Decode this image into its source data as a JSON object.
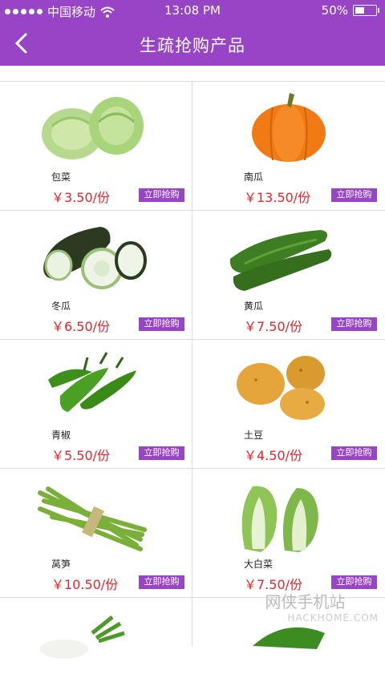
{
  "status": {
    "carrier": "中国移动",
    "time": "13:08 PM",
    "battery": "50%",
    "battery_level": 0.5
  },
  "header": {
    "title": "生疏抢购产品"
  },
  "products": [
    {
      "name": "包菜",
      "price": "￥3.50/份",
      "buy": "立即抢购",
      "icon": "cabbage-image"
    },
    {
      "name": "南瓜",
      "price": "￥13.50/份",
      "buy": "立即抢购",
      "icon": "pumpkin-image"
    },
    {
      "name": "冬瓜",
      "price": "￥6.50/份",
      "buy": "立即抢购",
      "icon": "winter-melon-image"
    },
    {
      "name": "黄瓜",
      "price": "￥7.50/份",
      "buy": "立即抢购",
      "icon": "cucumber-image"
    },
    {
      "name": "青椒",
      "price": "￥5.50/份",
      "buy": "立即抢购",
      "icon": "green-pepper-image"
    },
    {
      "name": "土豆",
      "price": "￥4.50/份",
      "buy": "立即抢购",
      "icon": "potato-image"
    },
    {
      "name": "莴笋",
      "price": "￥10.50/份",
      "buy": "立即抢购",
      "icon": "asparagus-image"
    },
    {
      "name": "大白菜",
      "price": "￥7.50/份",
      "buy": "立即抢购",
      "icon": "chinese-cabbage-image"
    }
  ],
  "watermark": {
    "line1": "网侠手机站",
    "line2": "HACKHOME.COM"
  },
  "colors": {
    "accent": "#9844c6",
    "price": "#e3262a"
  }
}
